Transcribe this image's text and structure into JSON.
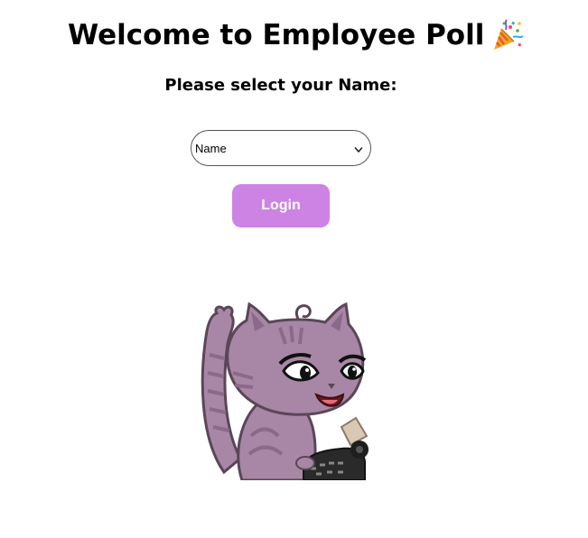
{
  "header": {
    "title": "Welcome to Employee Poll",
    "title_emoji": "party-popper-icon"
  },
  "login_form": {
    "prompt": "Please select your Name:",
    "name_select": {
      "selected": "Name"
    },
    "login_label": "Login"
  },
  "illustration": {
    "icon": "cat-typewriter-illustration"
  },
  "colors": {
    "login_button": "#cd83e4",
    "cat_fur": "#a887a6"
  }
}
